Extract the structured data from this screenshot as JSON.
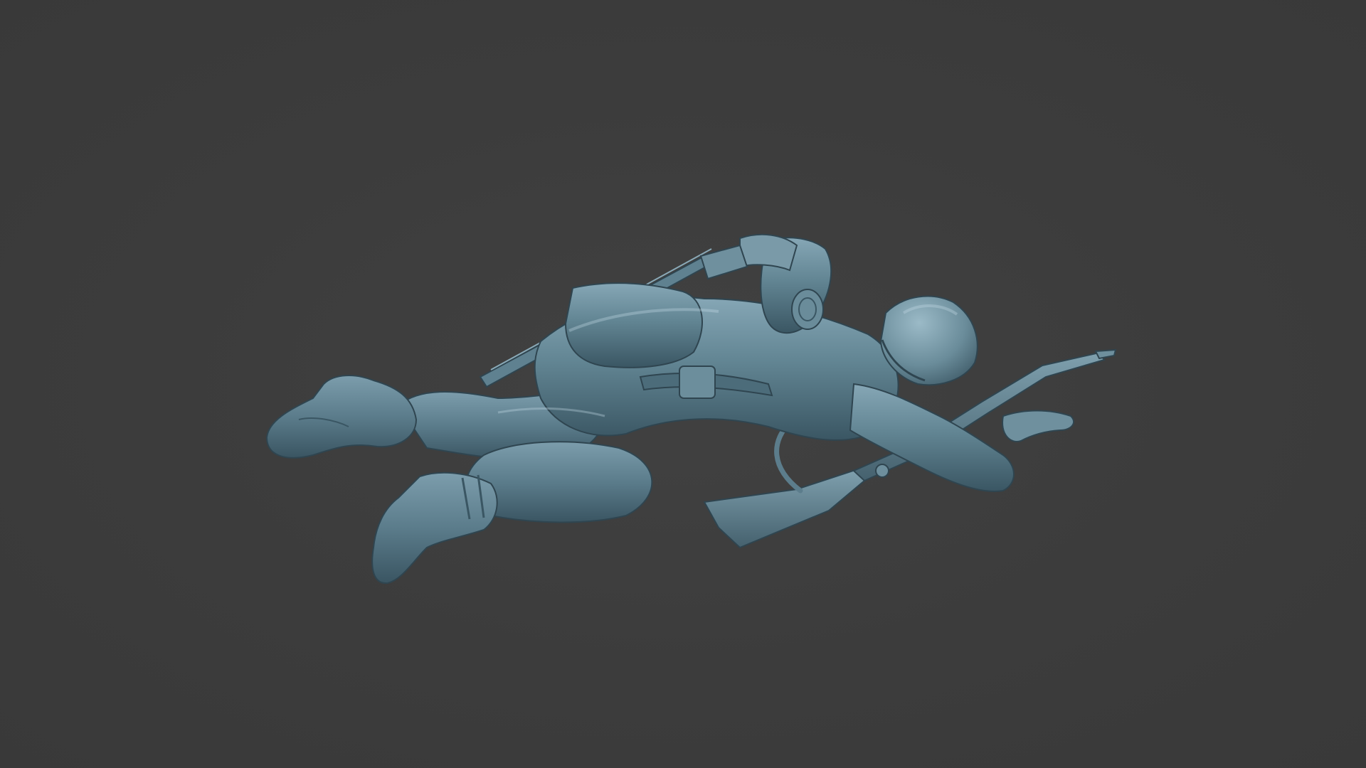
{
  "viewport": {
    "background_color": "#3c3c3c"
  },
  "model": {
    "subject": "prone-soldier-miniature",
    "material_color": "#5f7f8e",
    "shadow_color": "#2f4550",
    "highlight_color": "#8fb0be"
  }
}
